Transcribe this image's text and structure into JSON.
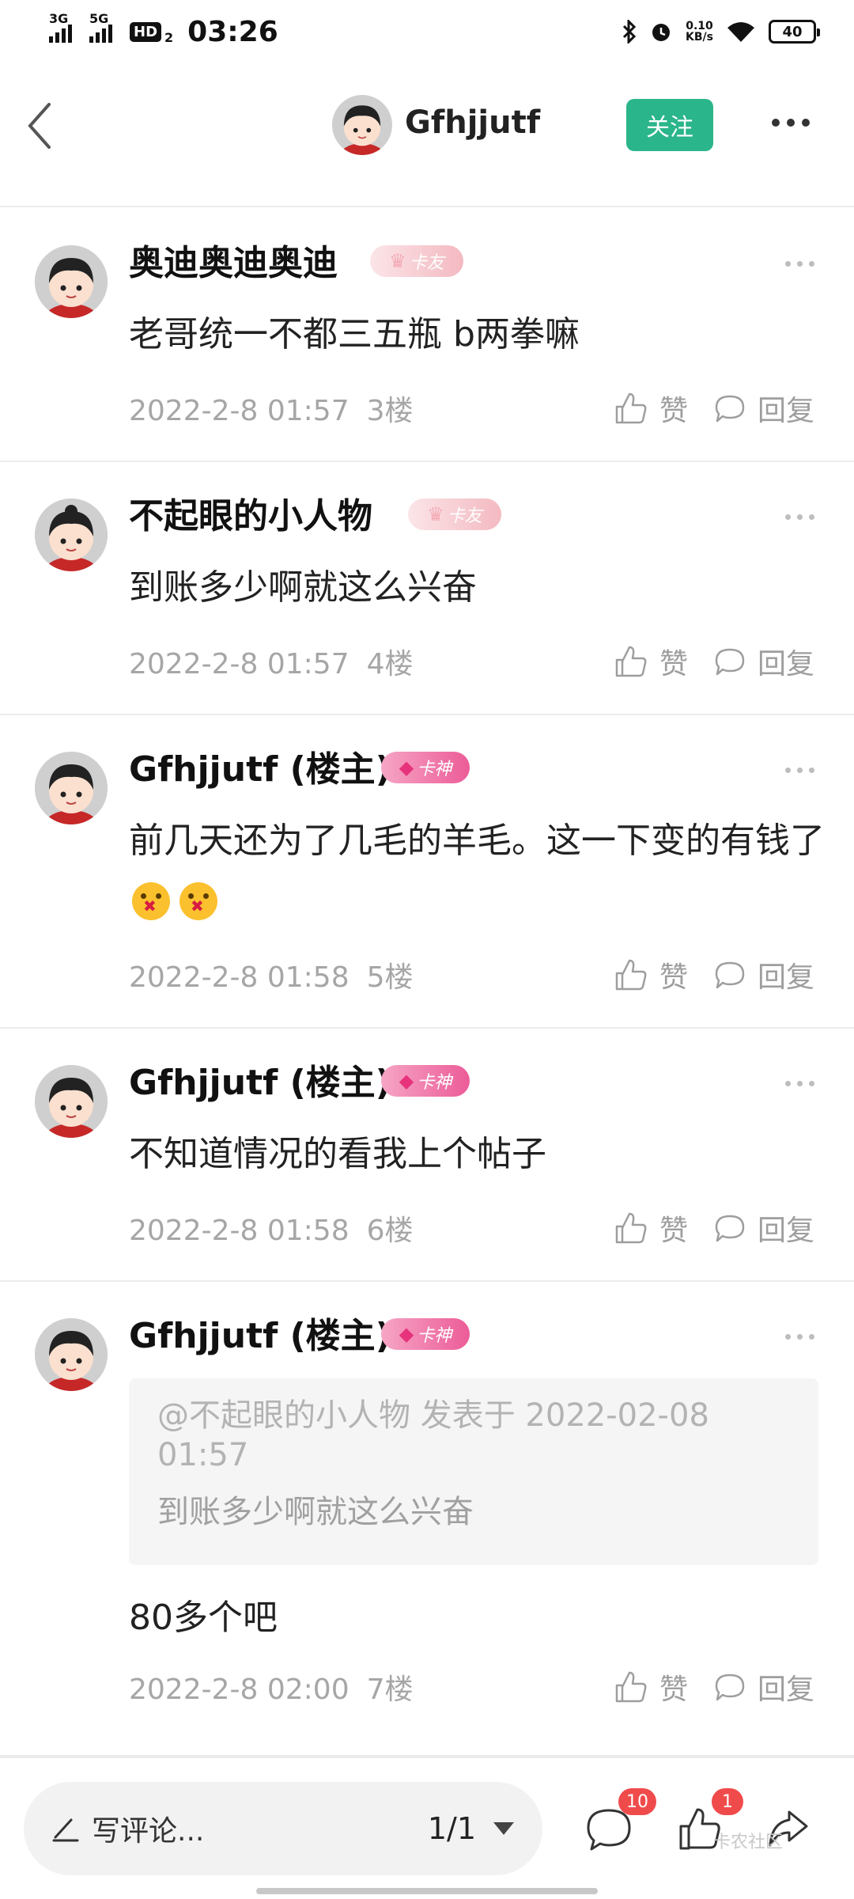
{
  "status_bar": {
    "net1": "3G",
    "net2": "5G",
    "hd": "HD",
    "hd_sub": "2",
    "time": "03:26",
    "speed_value": "0.10",
    "speed_unit": "KB/s",
    "battery": "40"
  },
  "header": {
    "title": "Gfhjjutf",
    "follow_label": "关注"
  },
  "comments": [
    {
      "name": "奥迪奥迪奥迪",
      "badge": "卡友",
      "badge_type": "fan",
      "text": "老哥统一不都三五瓶 b两拳嘛",
      "date": "2022-2-8 01:57",
      "floor": "3楼",
      "like_label": "赞",
      "reply_label": "回复"
    },
    {
      "name": "不起眼的小人物",
      "badge": "卡友",
      "badge_type": "fan",
      "text": "到账多少啊就这么兴奋",
      "date": "2022-2-8 01:57",
      "floor": "4楼",
      "like_label": "赞",
      "reply_label": "回复"
    },
    {
      "name": "Gfhjjutf (楼主)",
      "badge": "卡神",
      "badge_type": "god",
      "text": "前几天还为了几毛的羊毛。这一下变的有钱了",
      "emojis": [
        "shushing-emoji",
        "shushing-emoji"
      ],
      "date": "2022-2-8 01:58",
      "floor": "5楼",
      "like_label": "赞",
      "reply_label": "回复"
    },
    {
      "name": "Gfhjjutf (楼主)",
      "badge": "卡神",
      "badge_type": "god",
      "text": "不知道情况的看我上个帖子",
      "date": "2022-2-8 01:58",
      "floor": "6楼",
      "like_label": "赞",
      "reply_label": "回复"
    },
    {
      "name": "Gfhjjutf (楼主)",
      "badge": "卡神",
      "badge_type": "god",
      "quote_header": "@不起眼的小人物 发表于 2022-02-08 01:57",
      "quote_body": "到账多少啊就这么兴奋",
      "text": "80多个吧",
      "date": "2022-2-8 02:00",
      "floor": "7楼",
      "like_label": "赞",
      "reply_label": "回复"
    }
  ],
  "bottom_bar": {
    "comment_placeholder": "写评论...",
    "pager": "1/1",
    "comment_count": "10",
    "like_count": "1",
    "watermark": "卡农社区"
  },
  "colors": {
    "accent": "#2bb58a",
    "badge_red": "#f04b4b",
    "meta_gray": "#a6a6a6"
  }
}
